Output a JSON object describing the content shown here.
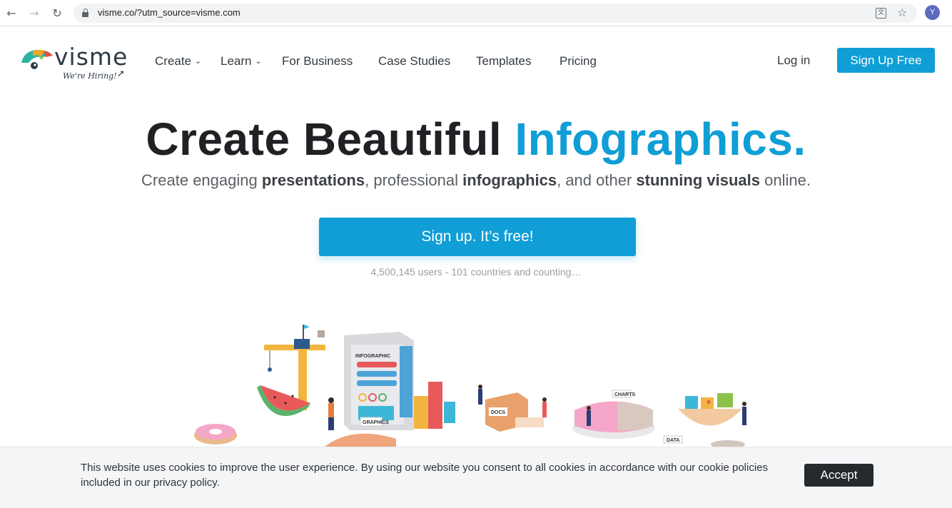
{
  "browser": {
    "url": "visme.co/?utm_source=visme.com",
    "profile_initial": "Y",
    "icons": [
      "back-arrow-icon",
      "forward-arrow-icon",
      "reload-icon",
      "lock-icon",
      "translate-icon",
      "star-icon"
    ]
  },
  "logo": {
    "name": "visme",
    "tagline": "We're Hiring!",
    "colors": [
      "#f6a623",
      "#e94e3c",
      "#2bb5a0",
      "#8bc34a",
      "#2f3a45"
    ]
  },
  "nav": {
    "items": [
      {
        "label": "Create",
        "has_dropdown": true
      },
      {
        "label": "Learn",
        "has_dropdown": true
      },
      {
        "label": "For Business",
        "has_dropdown": false
      },
      {
        "label": "Case Studies",
        "has_dropdown": false
      },
      {
        "label": "Templates",
        "has_dropdown": false
      },
      {
        "label": "Pricing",
        "has_dropdown": false
      }
    ],
    "login": "Log in",
    "signup": "Sign Up Free"
  },
  "hero": {
    "headline_main": "Create Beautiful ",
    "headline_accent": "Infographics.",
    "sub_1": "Create engaging ",
    "sub_2": "presentations",
    "sub_3": ", professional ",
    "sub_4": "infographics",
    "sub_5": ", and other ",
    "sub_6": "stunning visuals",
    "sub_7": " online.",
    "cta": "Sign up. It’s free!",
    "counter": "4,500,145 users - 101 countries and counting…"
  },
  "illustration": {
    "tags": [
      "INFOGRAPHIC",
      "GRAPHICS",
      "DOCS",
      "CHARTS",
      "DATA"
    ]
  },
  "cookie": {
    "text": "This website uses cookies to improve the user experience. By using our website you consent to all cookies in accordance with our cookie policies included in our privacy policy.",
    "accept": "Accept"
  },
  "colors": {
    "accent": "#0f9ed5",
    "headline": "#1f2125",
    "cookie_button": "#26292e"
  }
}
